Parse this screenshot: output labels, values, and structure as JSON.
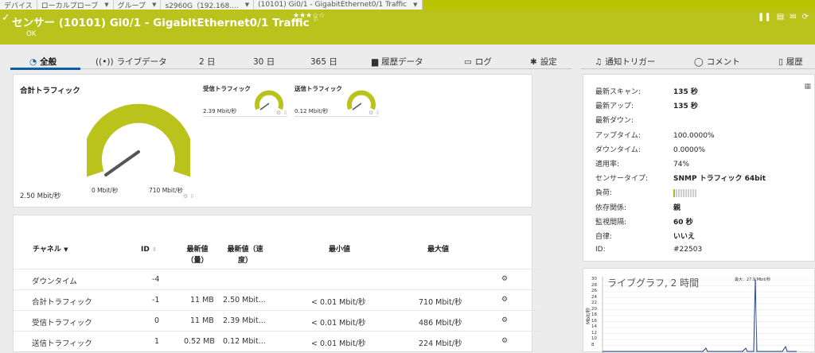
{
  "breadcrumb": [
    {
      "label": "デバイス"
    },
    {
      "label": "ローカルプローブ"
    },
    {
      "label": "グループ"
    },
    {
      "label": "s2960G（192.168...."
    },
    {
      "label": "(10101) Gi0/1 - GigabitEthernet0/1 Traffic"
    }
  ],
  "banner": {
    "title": "センサー (10101) Gi0/1 - GigabitEthernet0/1 Traffic",
    "stars": "★★★☆☆",
    "status": "OK",
    "bg": "#b9c31b"
  },
  "tabs": [
    {
      "label": "全般",
      "icon": "gauge-icon"
    },
    {
      "label": "ライブデータ",
      "icon": "live-icon"
    },
    {
      "label": "2 日",
      "icon": ""
    },
    {
      "label": "30 日",
      "icon": ""
    },
    {
      "label": "365 日",
      "icon": ""
    },
    {
      "label": "履歴データ",
      "icon": "chart-icon"
    },
    {
      "label": "ログ",
      "icon": "log-icon"
    },
    {
      "label": "設定",
      "icon": "gear-icon"
    },
    {
      "label": "通知トリガー",
      "icon": "bell-icon"
    },
    {
      "label": "コメント",
      "icon": "comment-icon"
    },
    {
      "label": "履歴",
      "icon": "history-icon"
    }
  ],
  "gauges": {
    "total": {
      "title": "合計トラフィック",
      "current": "2.50 Mbit/秒",
      "min": "0 Mbit/秒",
      "max": "710 Mbit/秒",
      "fraction": 0.0035
    },
    "recv": {
      "title": "受信トラフィック",
      "current": "2.39 Mbit/秒",
      "fraction": 0.005
    },
    "send": {
      "title": "送信トラフィック",
      "current": "0.12 Mbit/秒",
      "fraction": 0.0005
    }
  },
  "channels": {
    "headers": {
      "channel": "チャネル",
      "id": "ID",
      "latest_vol": "最新値（量）",
      "latest_speed": "最新値（速度）",
      "min": "最小値",
      "max": "最大値"
    },
    "rows": [
      {
        "name": "ダウンタイム",
        "id": "-4",
        "vol": "",
        "speed": "",
        "min": "",
        "max": ""
      },
      {
        "name": "合計トラフィック",
        "id": "-1",
        "vol": "11 MB",
        "speed": "2.50 Mbit...",
        "min": "< 0.01 Mbit/秒",
        "max": "710 Mbit/秒"
      },
      {
        "name": "受信トラフィック",
        "id": "0",
        "vol": "11 MB",
        "speed": "2.39 Mbit...",
        "min": "< 0.01 Mbit/秒",
        "max": "486 Mbit/秒"
      },
      {
        "name": "送信トラフィック",
        "id": "1",
        "vol": "0.52 MB",
        "speed": "0.12 Mbit...",
        "min": "< 0.01 Mbit/秒",
        "max": "224 Mbit/秒"
      }
    ]
  },
  "info": [
    {
      "label": "最新スキャン:",
      "value": "135 秒",
      "bold": true
    },
    {
      "label": "最新アップ:",
      "value": "135 秒",
      "bold": true
    },
    {
      "label": "最新ダウン:",
      "value": "",
      "bold": false
    },
    {
      "label": "アップタイム:",
      "value": "100.0000%",
      "bold": false
    },
    {
      "label": "ダウンタイム:",
      "value": "0.0000%",
      "bold": false
    },
    {
      "label": "適用率:",
      "value": "74%",
      "bold": false
    },
    {
      "label": "センサータイプ:",
      "value": "SNMP トラフィック 64bit",
      "bold": true
    },
    {
      "label": "負荷:",
      "value": "",
      "bold": false,
      "load_fraction": 0.1
    },
    {
      "label": "依存関係:",
      "value": "親",
      "bold": true
    },
    {
      "label": "監視間隔:",
      "value": "60 秒",
      "bold": true
    },
    {
      "label": "自律:",
      "value": "いいえ",
      "bold": true
    },
    {
      "label": "ID:",
      "value": "#22503",
      "bold": false
    }
  ],
  "live_graph": {
    "title": "ライブグラフ, 2 時間",
    "ylabel": "Mbit/秒",
    "max_label": "最大：27.9 Mbit/秒",
    "y_ticks": [
      "30",
      "28",
      "26",
      "24",
      "22",
      "20",
      "18",
      "16",
      "14",
      "12",
      "10",
      "8"
    ]
  },
  "colors": {
    "accent": "#b9c31b",
    "tab_active": "#0d5ea8",
    "gauge": "#b9c31b",
    "needle": "#555555"
  }
}
